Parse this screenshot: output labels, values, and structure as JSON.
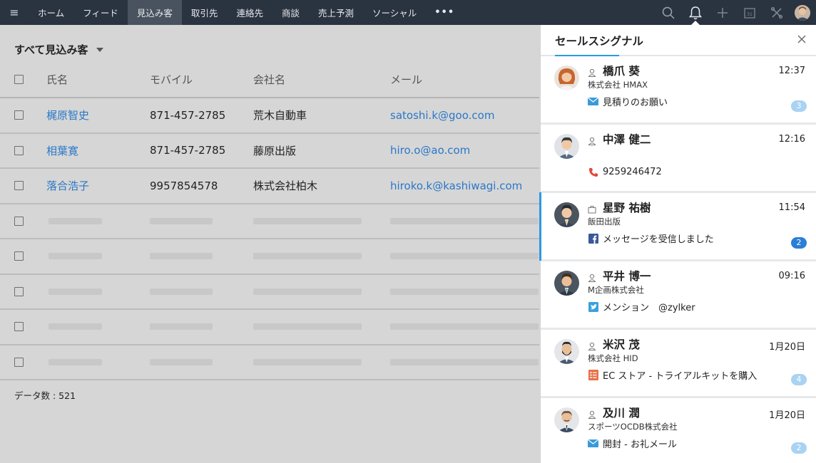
{
  "topnav": {
    "items": [
      "ホーム",
      "フィード",
      "見込み客",
      "取引先",
      "連絡先",
      "商談",
      "売上予測",
      "ソーシャル"
    ],
    "active_index": 2,
    "more": "•••",
    "icons": [
      "search-icon",
      "bell-icon",
      "plus-icon",
      "calendar-icon",
      "tools-icon",
      "user-avatar"
    ],
    "calendar_day": "31"
  },
  "list": {
    "view_title": "すべて見込み客",
    "columns": [
      "氏名",
      "モバイル",
      "会社名",
      "メール"
    ],
    "rows": [
      {
        "name": "梶原智史",
        "mobile": "871-457-2785",
        "company": "荒木自動車",
        "email": "satoshi.k@goo.com"
      },
      {
        "name": "相葉寛",
        "mobile": "871-457-2785",
        "company": "藤原出版",
        "email": "hiro.o@ao.com"
      },
      {
        "name": "落合浩子",
        "mobile": "9957854578",
        "company": "株式会社柏木",
        "email": "hiroko.k@kashiwagi.com"
      }
    ],
    "placeholder_rows": 5,
    "record_count": "データ数 : 521"
  },
  "signals": {
    "title": "セールスシグナル",
    "items": [
      {
        "name": "橋爪 葵",
        "time": "12:37",
        "company": "株式会社 HMAX",
        "message": "見積りのお願い",
        "source_icon": "email-icon",
        "badge": "3",
        "badge_strong": false,
        "selected": false,
        "avatar": "female-orange"
      },
      {
        "name": "中澤 健二",
        "time": "12:16",
        "company": "",
        "message": "9259246472",
        "source_icon": "phone-icon",
        "badge": "",
        "badge_strong": false,
        "selected": false,
        "avatar": "male-grey"
      },
      {
        "name": "星野 祐樹",
        "time": "11:54",
        "company": "飯田出版",
        "message": "メッセージを受信しました",
        "source_icon": "facebook-icon",
        "badge": "2",
        "badge_strong": true,
        "selected": true,
        "avatar": "male-dark"
      },
      {
        "name": "平井 博一",
        "time": "09:16",
        "company": "M企画株式会社",
        "message": "メンション　@zylker",
        "source_icon": "twitter-icon",
        "badge": "",
        "badge_strong": false,
        "selected": false,
        "avatar": "male-dark"
      },
      {
        "name": "米沢 茂",
        "time": "1月20日",
        "company": "株式会社 HID",
        "message": "EC ストア - トライアルキットを購入",
        "source_icon": "form-icon",
        "badge": "4",
        "badge_strong": false,
        "selected": false,
        "avatar": "male-beard"
      },
      {
        "name": "及川 潤",
        "time": "1月20日",
        "company": "スポーツOCDB株式会社",
        "message": "開封 - お礼メール",
        "source_icon": "email-icon",
        "badge": "2",
        "badge_strong": false,
        "selected": false,
        "avatar": "male-grey"
      }
    ]
  },
  "colors": {
    "nav_bg": "#2a3340",
    "nav_active": "#49535f",
    "link": "#2a78c8",
    "accent": "#2a9ae0"
  }
}
